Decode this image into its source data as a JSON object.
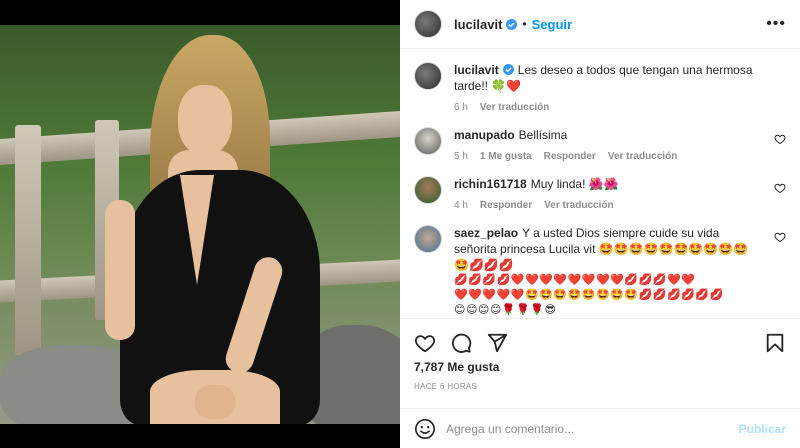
{
  "post": {
    "username": "lucilavit",
    "follow_label": "Seguir",
    "more_label": "•••"
  },
  "caption": {
    "username": "lucilavit",
    "text": "Les deseo a todos que tengan una hermosa tarde!! 🍀❤️",
    "time": "6 h",
    "translate": "Ver traducción"
  },
  "comments": [
    {
      "username": "manupado",
      "text": "Bellísima",
      "time": "5 h",
      "likes": "1 Me gusta",
      "reply": "Responder",
      "translate": "Ver traducción"
    },
    {
      "username": "richin161718",
      "text": "Muy linda! 🌺🌺",
      "time": "4 h",
      "reply": "Responder",
      "translate": "Ver traducción"
    },
    {
      "username": "saez_pelao",
      "text": "Y a usted Dios siempre cuide su vida señorita princesa Lucila vit 🤩🤩🤩🤩🤩🤩🤩🤩🤩🤩🤩💋💋💋",
      "emoji_line1": "💋💋💋💋❤️❤️❤️❤️❤️❤️❤️❤️💋💋💋❤️❤️",
      "emoji_line2": "❤️❤️❤️❤️❤️🤩🤩🤩🤩🤩🤩🤩🤩💋💋💋💋💋💋",
      "emoji_line3": "😊😊😊😊🌹🌹🌹😎"
    }
  ],
  "actions": {
    "like_icon": "heart-icon",
    "comment_icon": "comment-icon",
    "share_icon": "share-icon",
    "save_icon": "bookmark-icon"
  },
  "likes": "7,787 Me gusta",
  "time_ago": "HACE 6 HORAS",
  "add_comment": {
    "placeholder": "Agrega un comentario...",
    "publish_label": "Publicar"
  },
  "colors": {
    "accent": "#0095f6",
    "publish_disabled": "#b2dffc",
    "muted": "#8e8e8e",
    "text": "#262626"
  }
}
